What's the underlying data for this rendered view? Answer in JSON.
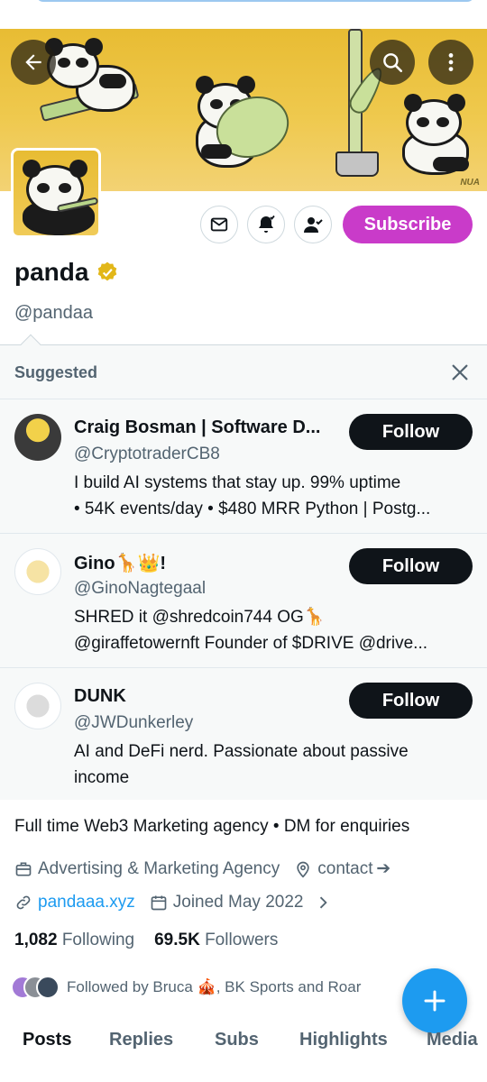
{
  "profile": {
    "name": "panda",
    "handle": "@pandaa",
    "bio": "Full time Web3 Marketing agency • DM for enquiries",
    "category": "Advertising & Marketing Agency",
    "location": "contact ➔",
    "website": "pandaaa.xyz",
    "joined": "Joined May 2022",
    "following_count": "1,082",
    "following_label": "Following",
    "followers_count": "69.5K",
    "followers_label": "Followers",
    "followed_by": "Followed by Bruca 🎪, BK Sports and Roar",
    "banner_signature": "NUA"
  },
  "actions": {
    "subscribe_label": "Subscribe"
  },
  "suggested": {
    "title": "Suggested",
    "items": [
      {
        "name": "Craig Bosman | Software D...",
        "handle": "@CryptotraderCB8",
        "bio_line1": "I build AI systems that stay up. 99% uptime",
        "bio_line2": "• 54K events/day • $480 MRR Python | Postg...",
        "follow_label": "Follow"
      },
      {
        "name": "Gino🦒👑!",
        "handle": "@GinoNagtegaal",
        "bio_line1": "SHRED it @shredcoin744 OG🦒",
        "bio_line2": "@giraffetowernft Founder of $DRIVE @drive...",
        "follow_label": "Follow"
      },
      {
        "name": "DUNK",
        "handle": "@JWDunkerley",
        "bio_line1": "AI and DeFi nerd. Passionate about passive",
        "bio_line2": "income",
        "follow_label": "Follow"
      }
    ]
  },
  "tabs": [
    "Posts",
    "Replies",
    "Subs",
    "Highlights",
    "Media"
  ],
  "colors": {
    "subscribe": "#c93bc9",
    "link": "#1d9bf0",
    "fab": "#1d9bf0",
    "verified": "#e2b719",
    "banner": "#e8bc33"
  },
  "icons": [
    "back-arrow-icon",
    "search-icon",
    "more-vertical-icon",
    "mail-icon",
    "notification-bell-icon",
    "following-person-check-icon",
    "verified-badge-icon",
    "close-icon",
    "briefcase-icon",
    "location-pin-icon",
    "link-icon",
    "calendar-icon",
    "chevron-right-icon",
    "plus-icon"
  ]
}
